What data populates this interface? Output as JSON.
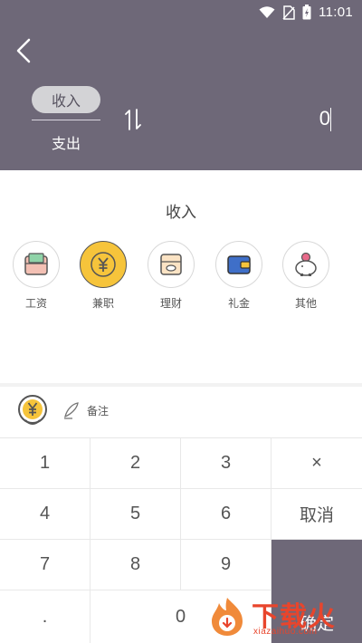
{
  "status_bar": {
    "time": "11:01"
  },
  "header": {
    "selected_type": "收入",
    "other_type": "支出",
    "amount": "0"
  },
  "category_section": {
    "title": "收入",
    "items": [
      {
        "label": "工资",
        "icon": "salary-icon"
      },
      {
        "label": "兼职",
        "icon": "part-time-yuan-icon"
      },
      {
        "label": "理财",
        "icon": "finance-icon"
      },
      {
        "label": "礼金",
        "icon": "wallet-icon"
      },
      {
        "label": "其他",
        "icon": "piggy-bank-icon"
      }
    ],
    "selected_index": 1
  },
  "note": {
    "label": "备注"
  },
  "keypad": {
    "keys": [
      "1",
      "2",
      "3",
      "×",
      "4",
      "5",
      "6",
      "取消",
      "7",
      "8",
      "9",
      ".",
      "0"
    ],
    "confirm": "确定"
  },
  "watermark": {
    "main": "下载火",
    "sub": "xiazaihuo.com"
  },
  "colors": {
    "header_bg": "#6e6878",
    "accent": "#f6c43b",
    "watermark": "#e8452c"
  }
}
